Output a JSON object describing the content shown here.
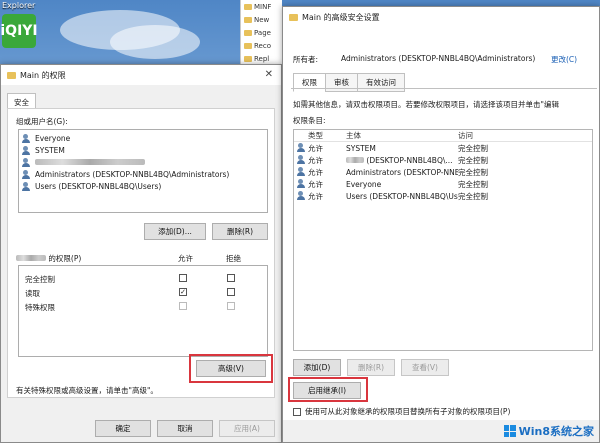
{
  "desktop": {
    "icon_label": "Explorer",
    "icon_brand": "iQIYI"
  },
  "explorer": {
    "items": [
      "MINF",
      "New",
      "Page",
      "Reco",
      "Repl"
    ]
  },
  "left_dialog": {
    "title": "Main 的权限",
    "tab": "安全",
    "group_label": "组或用户名(G):",
    "users": [
      {
        "name": "Everyone"
      },
      {
        "name": "SYSTEM"
      },
      {
        "name": ""
      },
      {
        "name": "Administrators (DESKTOP-NNBL4BQ\\Administrators)"
      },
      {
        "name": "Users (DESKTOP-NNBL4BQ\\Users)"
      }
    ],
    "add_button": "添加(D)...",
    "remove_button": "删除(R)",
    "perm_label": "的权限(P)",
    "allow_label": "允许",
    "deny_label": "拒绝",
    "permissions": [
      {
        "name": "完全控制",
        "allow": false,
        "deny": false
      },
      {
        "name": "读取",
        "allow": true,
        "deny": false
      },
      {
        "name": "特殊权限",
        "allow": false,
        "deny": false
      }
    ],
    "advanced_hint": "有关特殊权限或高级设置，请单击\"高级\"。",
    "advanced_button": "高级(V)",
    "ok_button": "确定",
    "cancel_button": "取消",
    "apply_button": "应用(A)"
  },
  "right_dialog": {
    "title": "Main 的高级安全设置",
    "owner_label": "所有者:",
    "owner_value": "Administrators (DESKTOP-NNBL4BQ\\Administrators)",
    "owner_change": "更改(C)",
    "tabs": [
      "权限",
      "审核",
      "有效访问"
    ],
    "info_text": "如需其他信息，请双击权限项目。若要修改权限项目，请选择该项目并单击\"编辑",
    "entries_label": "权限条目:",
    "columns": [
      "类型",
      "主体",
      "访问"
    ],
    "entries": [
      {
        "type": "允许",
        "principal": "SYSTEM",
        "access": "完全控制"
      },
      {
        "type": "允许",
        "principal": "(DESKTOP-NNBL4BQ\\...",
        "access": "完全控制"
      },
      {
        "type": "允许",
        "principal": "Administrators (DESKTOP-NNBL...",
        "access": "完全控制"
      },
      {
        "type": "允许",
        "principal": "Everyone",
        "access": "完全控制"
      },
      {
        "type": "允许",
        "principal": "Users (DESKTOP-NNBL4BQ\\Use...",
        "access": "完全控制"
      }
    ],
    "add_button": "添加(D)",
    "remove_button": "删除(R)",
    "view_button": "查看(V)",
    "inherit_button": "启用继承(I)",
    "replace_checkbox_label": "使用可从此对象继承的权限项目替换所有子对象的权限项目(P)"
  },
  "watermark": {
    "text": "Win8系统之家"
  }
}
